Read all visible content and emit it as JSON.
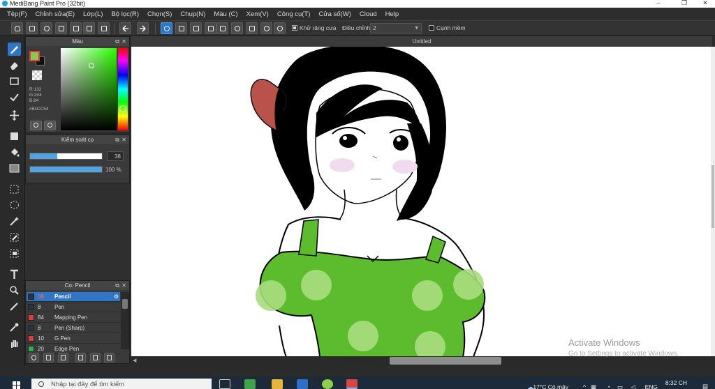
{
  "window": {
    "title": "MediBang Paint Pro (32bit)",
    "buttons": [
      "–",
      "❐",
      "✕"
    ]
  },
  "menu": [
    "Tệp(F)",
    "Chỉnh sửa(E)",
    "Lớp(L)",
    "Bộ lọc(R)",
    "Chọn(S)",
    "Chụp(N)",
    "Màu (C)",
    "Xem(V)",
    "Công cụ(T)",
    "Cửa số(W)",
    "Cloud",
    "Help"
  ],
  "toolbar": {
    "antialias_label": "Khử răng cưa",
    "antialias_checked": true,
    "adjust_label": "Điều chỉnh",
    "adjust_value": "2",
    "smooth_label": "Cạnh mềm",
    "smooth_checked": false
  },
  "color_panel": {
    "title": "Màu",
    "r": "R:132",
    "g": "G:204",
    "b": "B:84",
    "hex": "#84CC54",
    "foreground": "#84CC54",
    "background": "#111111"
  },
  "brush_control": {
    "title": "Kiểm soát cọ",
    "size_value": "38",
    "size_fraction": 0.38,
    "opacity_value": "100 %",
    "opacity_fraction": 1.0
  },
  "brush_panel": {
    "title": "Cọ: Pencil",
    "items": [
      {
        "size": "38",
        "name": "Pencil",
        "color": "#2a3440",
        "selected": true
      },
      {
        "size": "8",
        "name": "Pen",
        "color": "#2a3440",
        "selected": false
      },
      {
        "size": "84",
        "name": "Mapping Pen",
        "color": "#e03c3c",
        "selected": false
      },
      {
        "size": "8",
        "name": "Pen (Sharp)",
        "color": "#2a3440",
        "selected": false
      },
      {
        "size": "10",
        "name": "G Pen",
        "color": "#e03c3c",
        "selected": false
      },
      {
        "size": "20",
        "name": "Edge Pen",
        "color": "#27b34a",
        "selected": false
      }
    ]
  },
  "canvas": {
    "tab_title": "Untitled"
  },
  "watermark": {
    "line1": "Activate Windows",
    "line2": "Go to Settings to activate Windows."
  },
  "taskbar": {
    "search_placeholder": "Nhập tại đây để tìm kiếm",
    "weather": "17°C  Có mây",
    "language": "ENG",
    "time": "8:32 CH"
  }
}
